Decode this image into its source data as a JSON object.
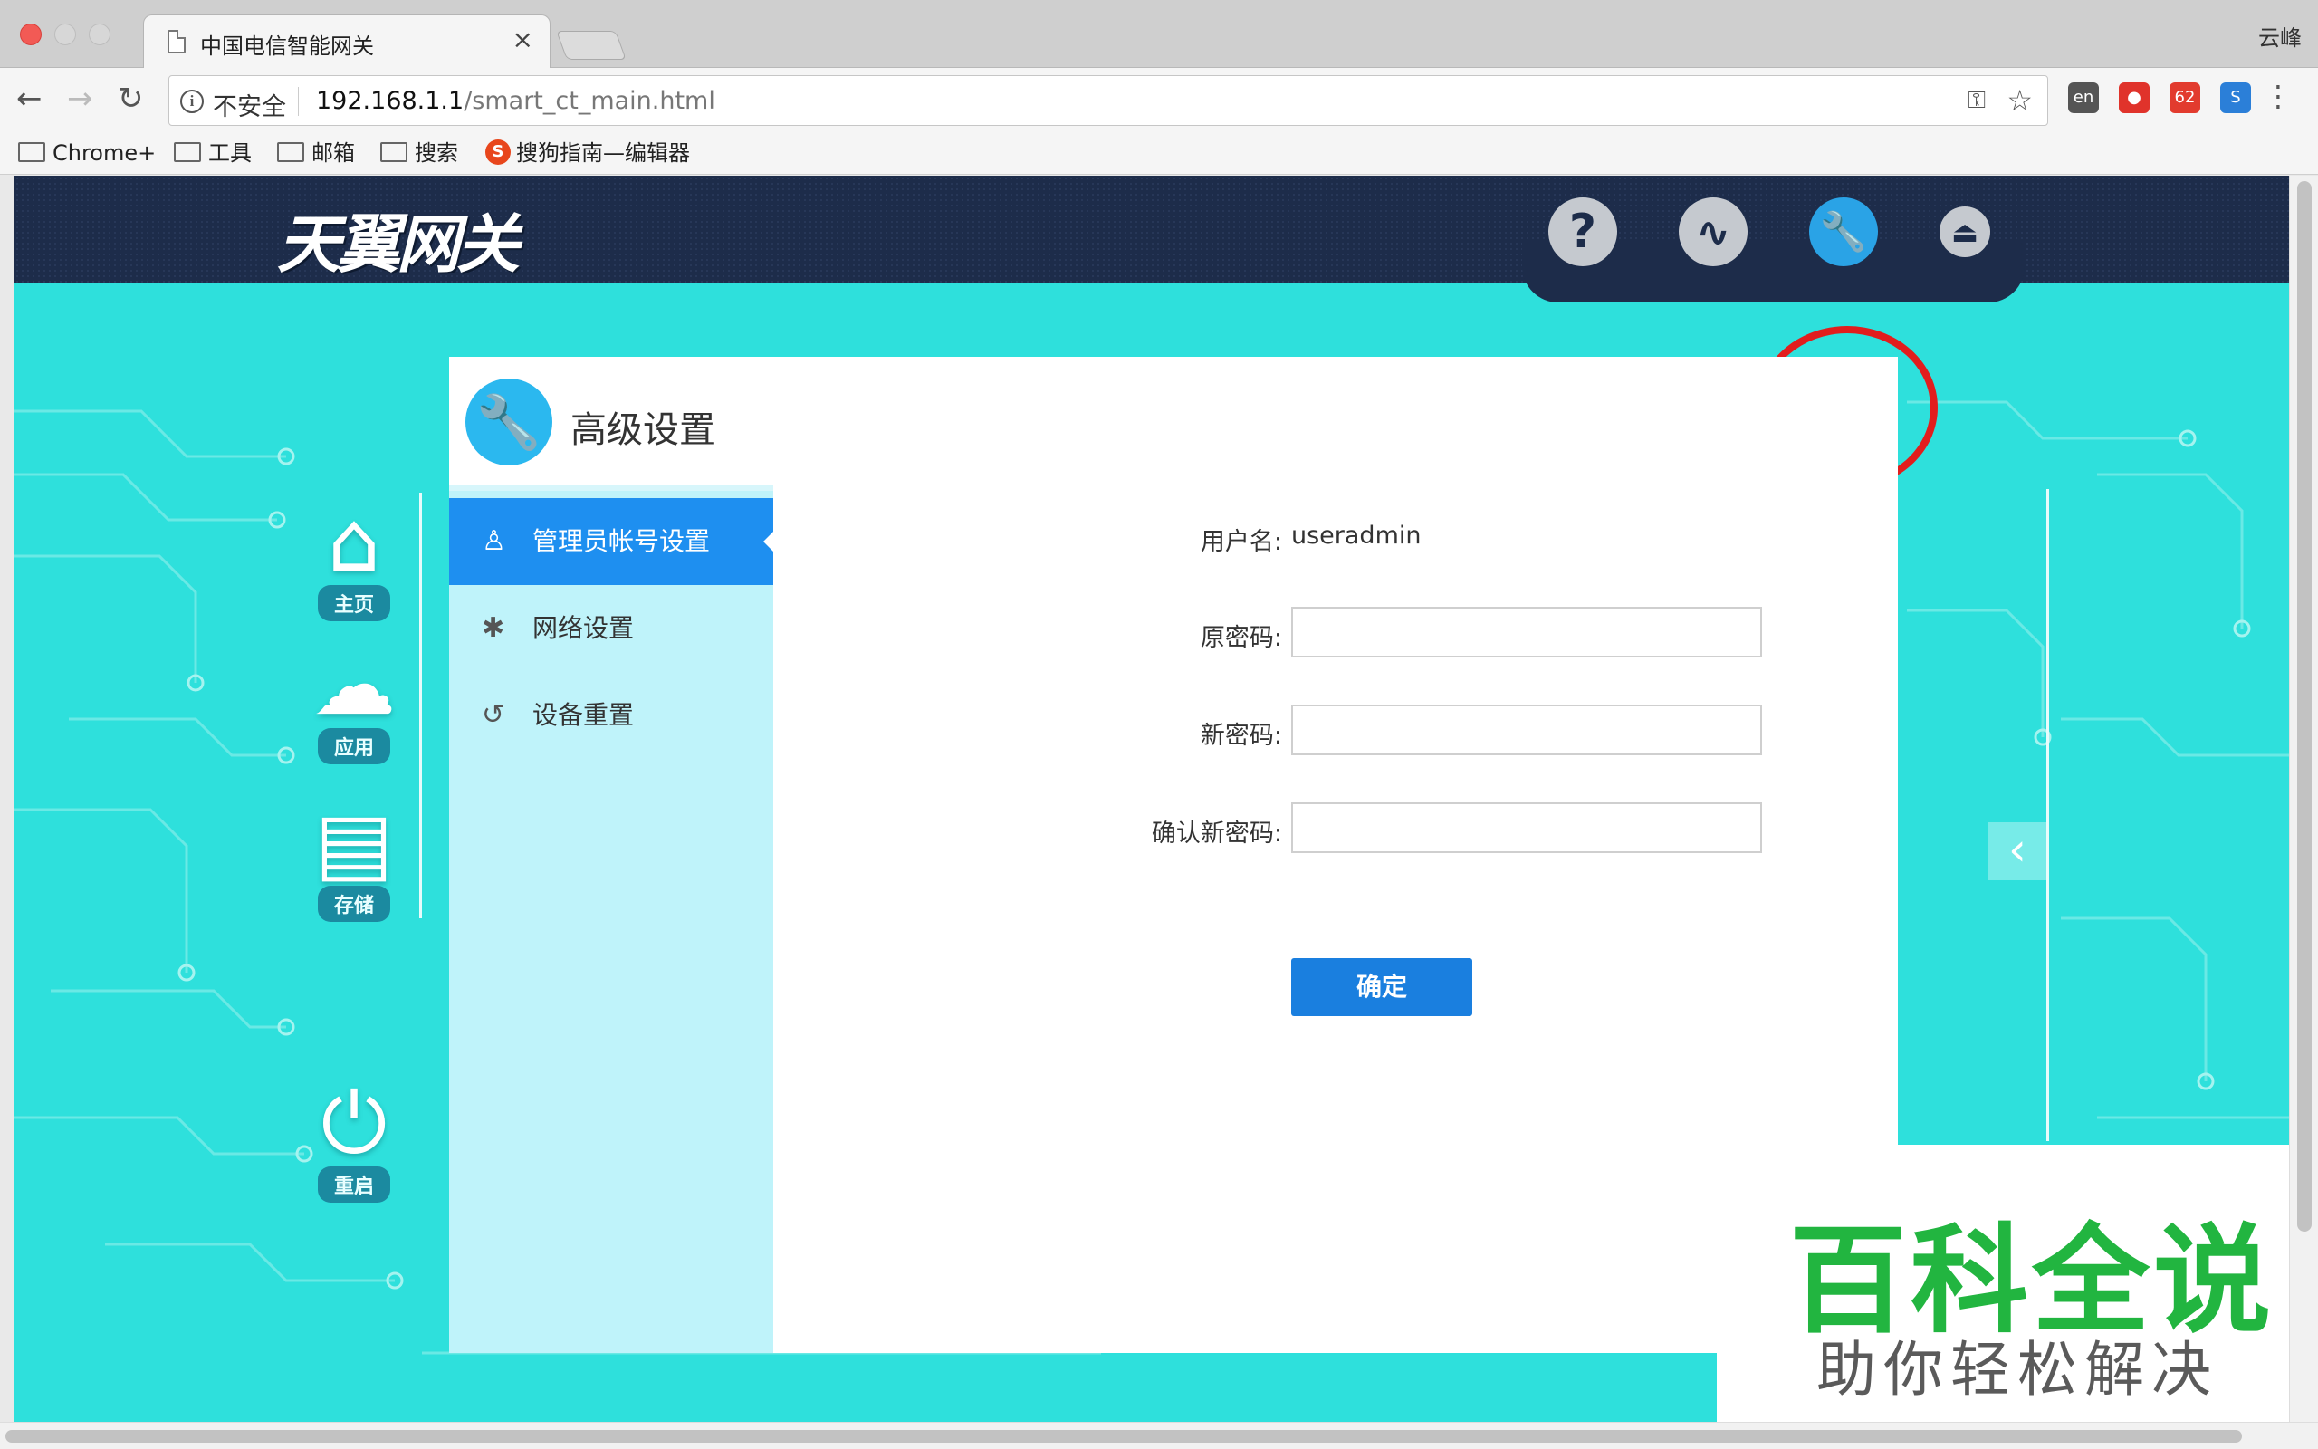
{
  "browser": {
    "tab_title": "中国电信智能网关",
    "tab_close": "×",
    "profile_name": "云峰",
    "security_label": "不安全",
    "url_host": "192.168.1.1",
    "url_path": "/smart_ct_main.html",
    "back_glyph": "←",
    "forward_glyph": "→",
    "reload_glyph": "↻",
    "extensions": [
      {
        "name": "translate-extension-icon",
        "glyph": "en",
        "color": "#555555"
      },
      {
        "name": "adblock-extension-icon",
        "glyph": "●",
        "color": "#e0332b"
      },
      {
        "name": "badge-extension-icon",
        "glyph": "62",
        "color": "#e23b2e"
      },
      {
        "name": "s-extension-icon",
        "glyph": "S",
        "color": "#2b7fd8"
      }
    ],
    "bookmarks": [
      "Chrome+",
      "工具",
      "邮箱",
      "搜索",
      "搜狗指南—编辑器"
    ]
  },
  "router": {
    "logo": "天翼网关",
    "header_icons": [
      {
        "name": "help-icon",
        "glyph": "?"
      },
      {
        "name": "status-chart-icon",
        "glyph": "∿"
      },
      {
        "name": "advanced-settings-wrench-icon",
        "glyph": "🔧"
      },
      {
        "name": "logout-icon",
        "glyph": "⏏"
      }
    ],
    "rail": [
      {
        "name": "home",
        "label": "主页",
        "glyph": "⌂"
      },
      {
        "name": "apps",
        "label": "应用",
        "glyph": "☁"
      },
      {
        "name": "storage",
        "label": "存储",
        "glyph": "▤"
      },
      {
        "name": "restart",
        "label": "重启",
        "glyph": "⏻"
      }
    ],
    "panel": {
      "title": "高级设置",
      "menu": [
        {
          "label": "管理员帐号设置",
          "glyph": "♙",
          "active": true
        },
        {
          "label": "网络设置",
          "glyph": "✱",
          "active": false
        },
        {
          "label": "设备重置",
          "glyph": "↺",
          "active": false
        }
      ],
      "form": {
        "username_label": "用户名:",
        "username_value": "useradmin",
        "old_password_label": "原密码:",
        "new_password_label": "新密码:",
        "confirm_password_label": "确认新密码:",
        "old_password_value": "",
        "new_password_value": "",
        "confirm_password_value": "",
        "submit_label": "确定"
      }
    },
    "collapse_glyph": "‹"
  },
  "watermark": {
    "main": "百科全说",
    "sub": "助你轻松解决"
  }
}
